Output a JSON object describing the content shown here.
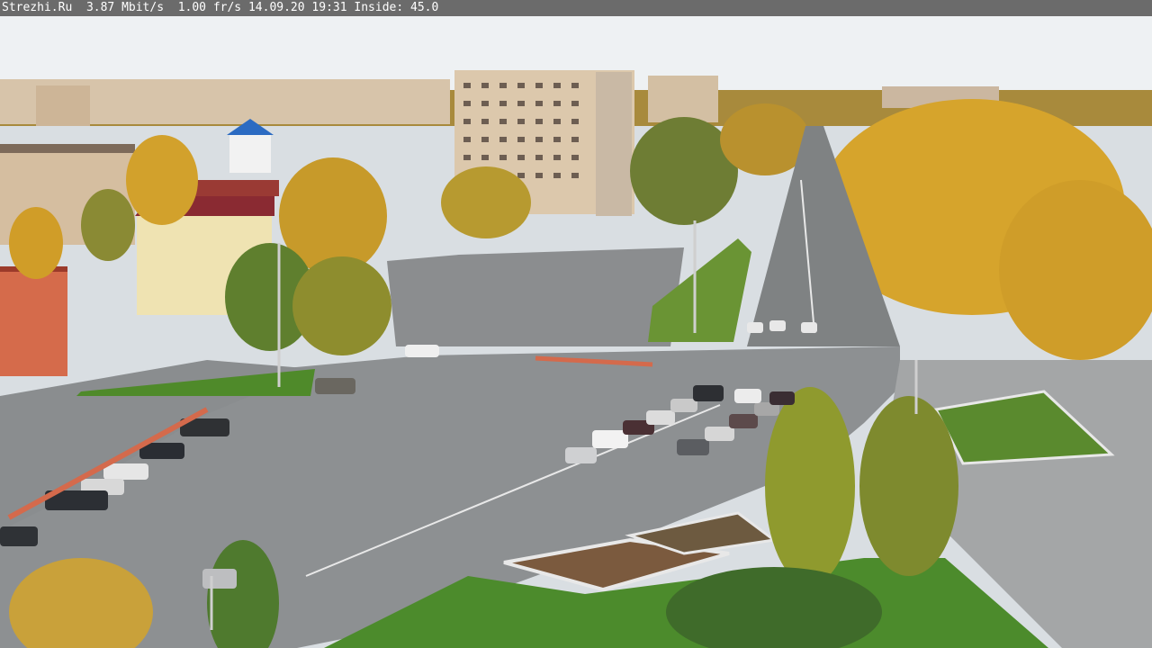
{
  "camera_overlay": {
    "site": "Strezhi.Ru",
    "bitrate": "3.87 Mbit/s",
    "framerate": "1.00 fr/s",
    "date": "14.09.20",
    "time": "19:31",
    "inside": "Inside: 45.0"
  },
  "scene": {
    "description_colors": {
      "sky": "#eef1f3",
      "foliage_yellow": "#d4a52a",
      "foliage_green": "#6f8a3a",
      "asphalt": "#8f9192",
      "grass": "#5e8f32",
      "building_beige": "#d9c3a6",
      "roof_red": "#8a2a32"
    }
  }
}
